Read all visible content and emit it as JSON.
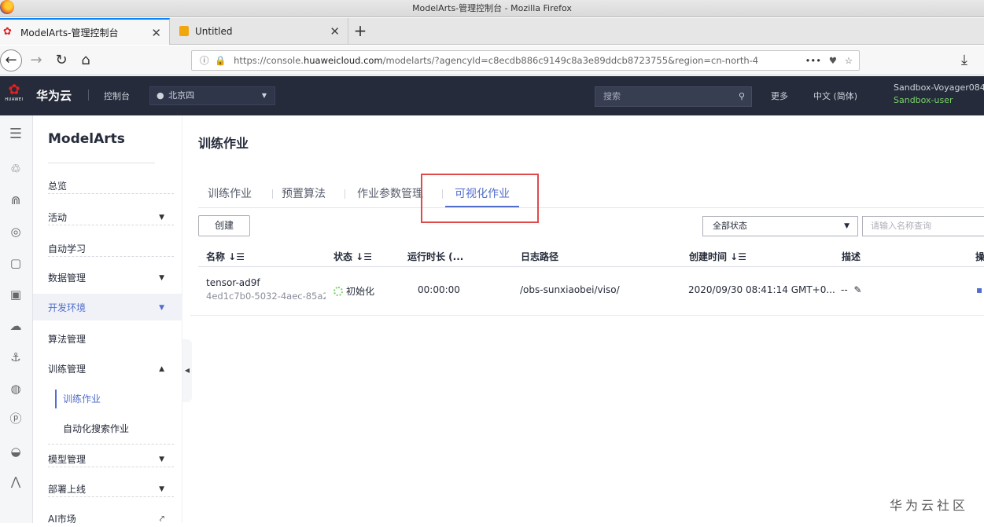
{
  "window": {
    "title": "ModelArts-管理控制台 - Mozilla Firefox"
  },
  "browser_tabs": [
    {
      "label": "ModelArts-管理控制台",
      "active": true
    },
    {
      "label": "Untitled",
      "active": false
    }
  ],
  "new_tab_glyph": "+",
  "url": {
    "prefix": "https://console.",
    "domain": "huaweicloud.com",
    "path": "/modelarts/?agencyId=c8ecdb886c9149c8a3e89ddcb8723755&region=cn-north-4",
    "more": "•••"
  },
  "topnav": {
    "brand": "华为云",
    "logo_text": "HUAWEI",
    "console": "控制台",
    "region": "北京四",
    "search_placeholder": "搜索",
    "more": "更多",
    "language": "中文 (简体)",
    "user_name": "Sandbox-Voyager084",
    "user_role": "Sandbox-user"
  },
  "sidebar": {
    "title": "ModelArts",
    "items": [
      {
        "label": "总览"
      },
      {
        "label": "活动"
      },
      {
        "label": "自动学习"
      },
      {
        "label": "数据管理"
      },
      {
        "label": "开发环境"
      },
      {
        "label": "算法管理"
      },
      {
        "label": "训练管理"
      },
      {
        "label": "训练作业"
      },
      {
        "label": "自动化搜索作业"
      },
      {
        "label": "模型管理"
      },
      {
        "label": "部署上线"
      },
      {
        "label": "AI市场"
      }
    ]
  },
  "main": {
    "title": "训练作业",
    "tabs": [
      {
        "label": "训练作业"
      },
      {
        "label": "预置算法"
      },
      {
        "label": "作业参数管理"
      },
      {
        "label": "可视化作业"
      }
    ],
    "create_label": "创建",
    "status_filter": "全部状态",
    "name_search_placeholder": "请输入名称查询",
    "columns": [
      "名称 ↓☰",
      "状态 ↓☰",
      "运行时长 (...",
      "日志路径",
      "创建时间 ↓☰",
      "描述",
      "操"
    ],
    "rows": [
      {
        "name": "tensor-ad9f",
        "id": "4ed1c7b0-5032-4aec-85a2-",
        "status": "初始化",
        "duration": "00:00:00",
        "log_path": "/obs-sunxiaobei/viso/",
        "created": "2020/09/30 08:41:14 GMT+0...",
        "description": "--"
      }
    ]
  },
  "watermark": "华为云社区",
  "colors": {
    "accent": "#526ecc",
    "topnav": "#252b3a",
    "highlight_box": "#e04a4a"
  }
}
